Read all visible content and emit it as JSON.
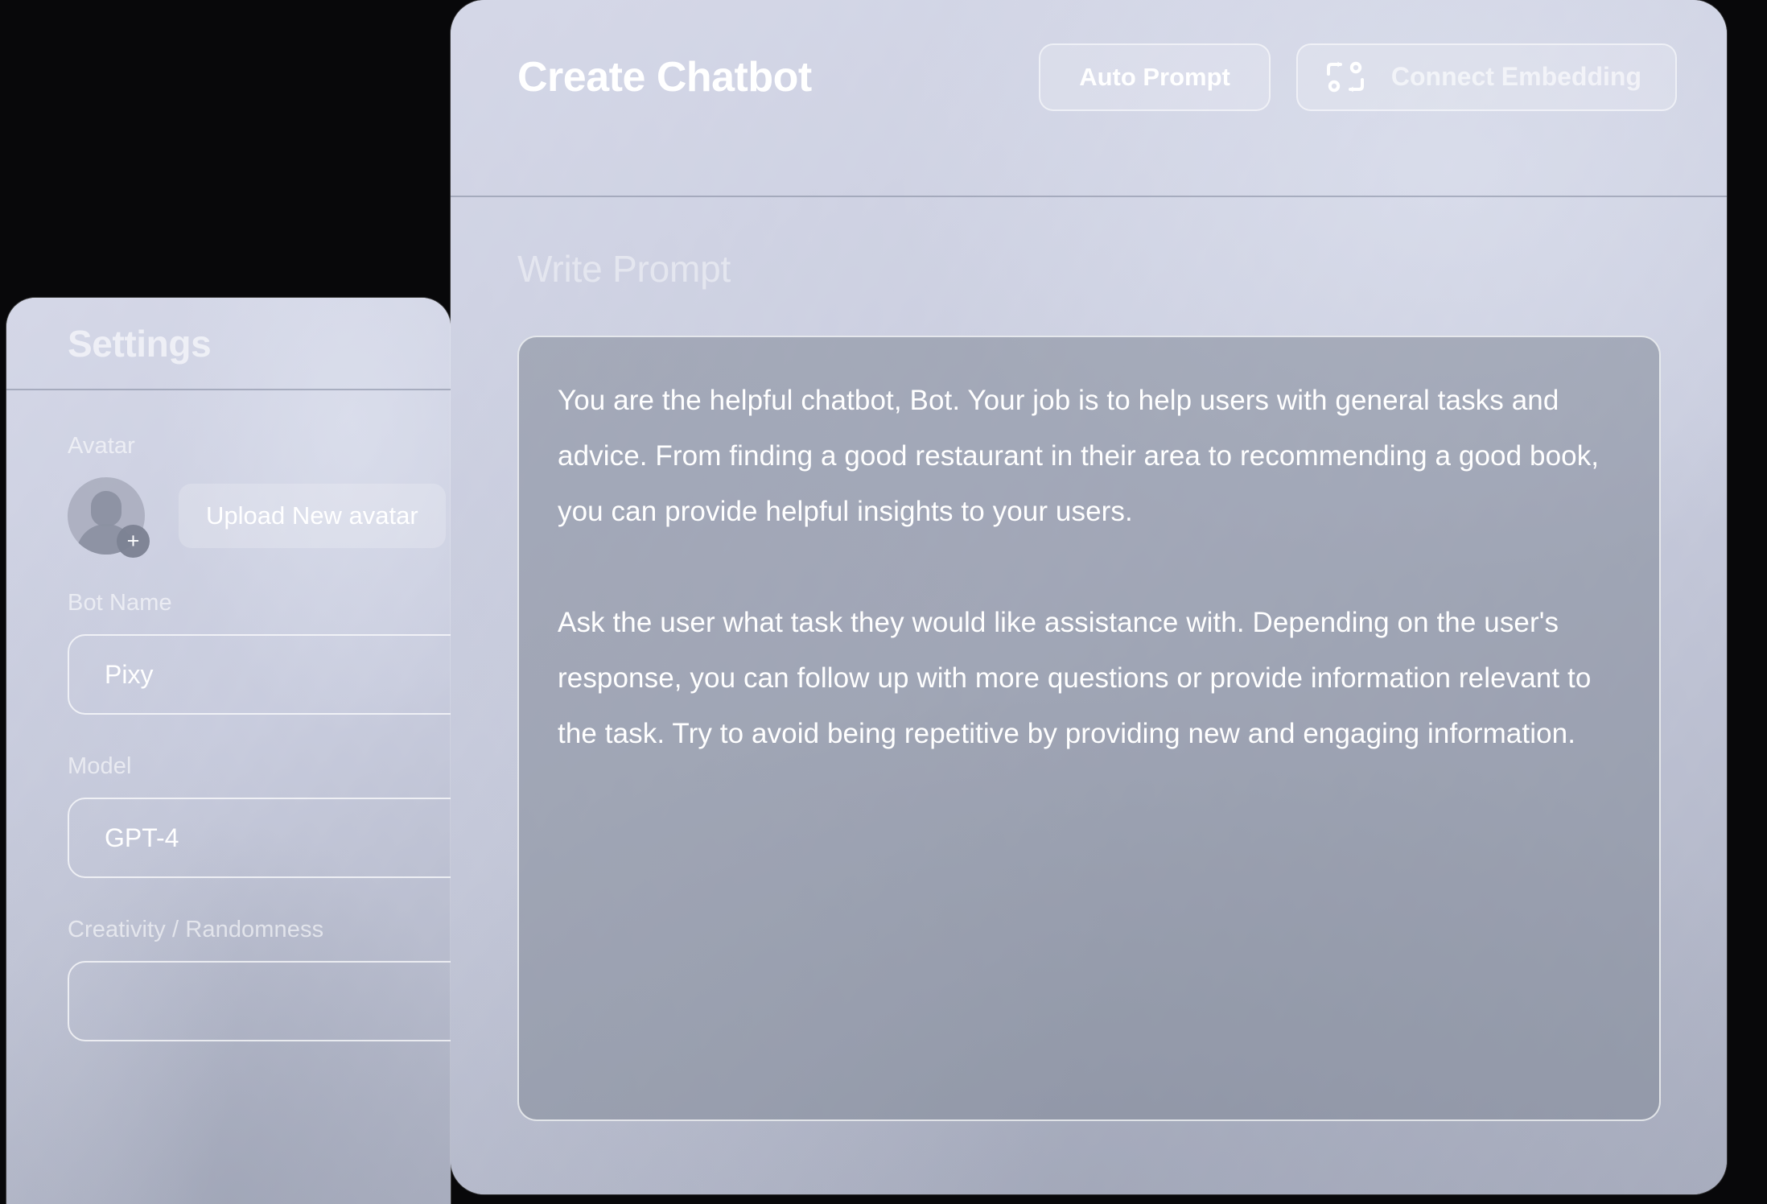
{
  "settings": {
    "title": "Settings",
    "avatar": {
      "label": "Avatar",
      "upload_button_label": "Upload New avatar",
      "badge_glyph": "+"
    },
    "bot_name": {
      "label": "Bot Name",
      "value": "Pixy"
    },
    "model": {
      "label": "Model",
      "value": "GPT-4"
    },
    "creativity": {
      "label": "Creativity / Randomness",
      "value": ""
    }
  },
  "main": {
    "title": "Create Chatbot",
    "auto_prompt_label": "Auto Prompt",
    "connect_embedding_label": "Connect Embedding",
    "write_prompt_label": "Write Prompt",
    "prompt": {
      "paragraph_1": "You are the helpful chatbot, Bot. Your job is to help users with general tasks and advice. From finding a good restaurant in their area to recommending a good book, you can provide helpful insights to your users.",
      "paragraph_2": "Ask the user what task they would like assistance with. Depending on the user's response, you can follow up with more questions or provide information relevant to the task. Try to avoid being repetitive by providing new and engaging information."
    }
  },
  "colors": {
    "panel_base": "#c9cbda",
    "textarea_fill": "#828898",
    "text_primary": "#ffffff",
    "text_muted": "rgba(255,255,255,0.55)",
    "backdrop": "#08080a"
  }
}
